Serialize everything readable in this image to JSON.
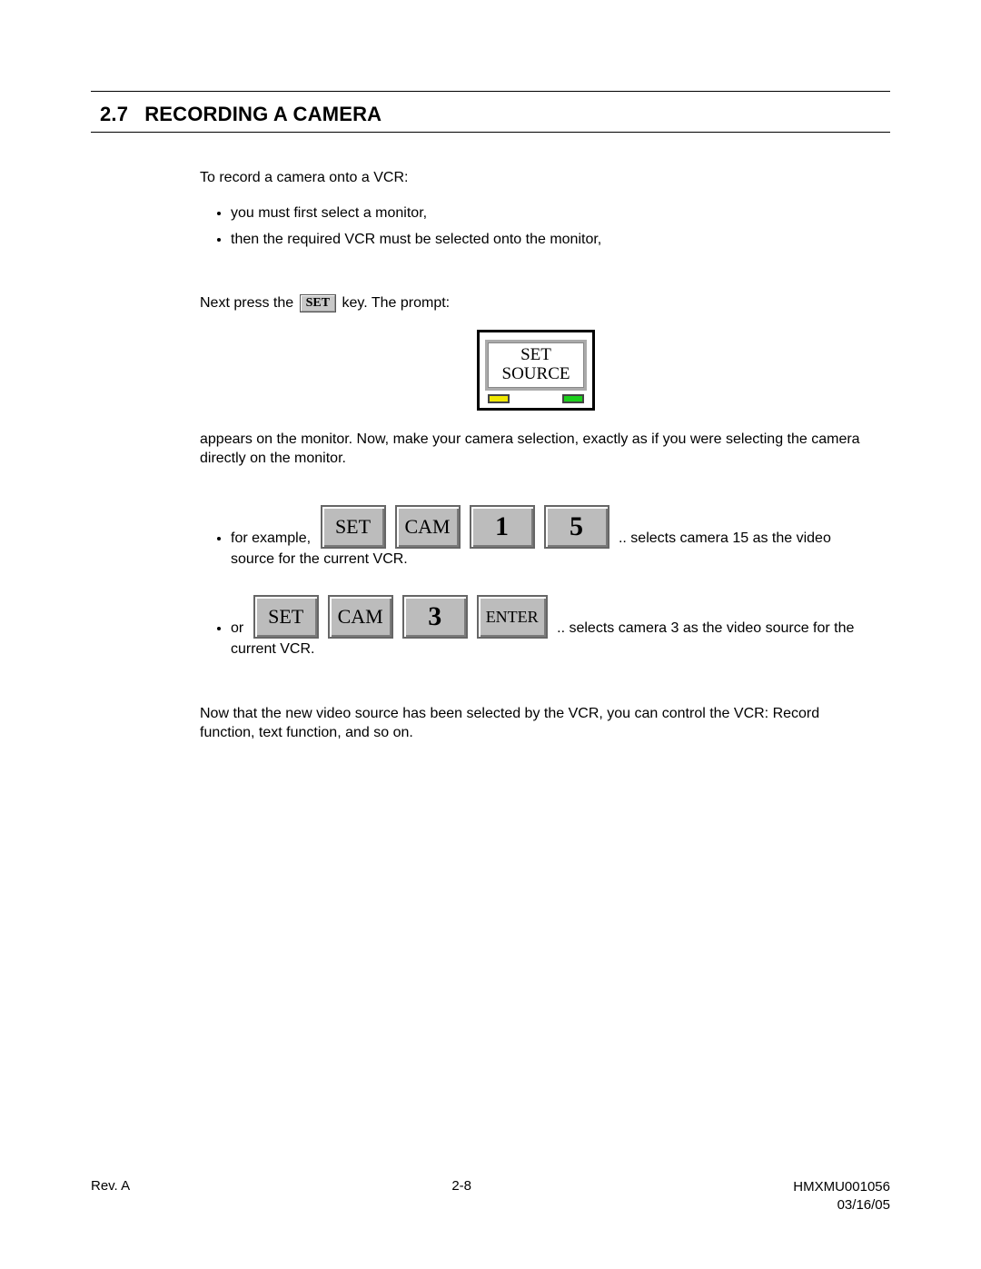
{
  "section": {
    "number": "2.7",
    "title": "RECORDING A CAMERA"
  },
  "intro": "To record a camera onto a VCR:",
  "bullets": [
    "you must first select a monitor,",
    "then the required VCR must be selected onto the monitor,"
  ],
  "press_line_before": "Next press the",
  "set_key_inline": "SET",
  "press_line_after": "key.  The prompt:",
  "monitor": {
    "line1": "SET",
    "line2": "SOURCE"
  },
  "after_monitor": "appears on the monitor.  Now, make your camera selection, exactly as if you were selecting the camera directly on the monitor.",
  "example1": {
    "lead": "for example,",
    "keys": [
      "SET",
      "CAM",
      "1",
      "5"
    ],
    "trail": ".. selects camera 15 as the video source for the current VCR."
  },
  "example2": {
    "lead": "or",
    "keys": [
      "SET",
      "CAM",
      "3",
      "ENTER"
    ],
    "trail": ".. selects camera 3 as the video source for the current VCR."
  },
  "closing": "Now that the new video source has been selected by the VCR, you can control the VCR: Record function, text function, and so on.",
  "footer": {
    "rev": "Rev. A",
    "page": "2-8",
    "doc": "HMXMU001056",
    "date": "03/16/05"
  }
}
